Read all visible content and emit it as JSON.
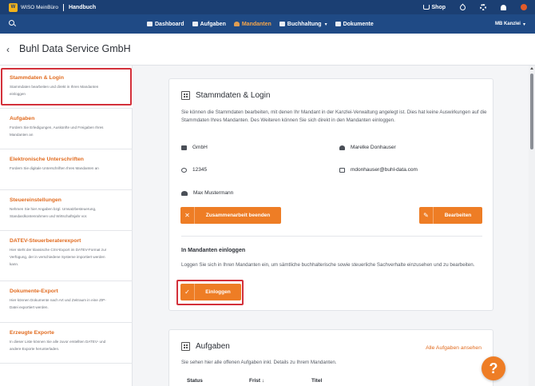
{
  "topbar": {
    "brand": "WISO MeinBüro",
    "handbook": "Handbuch",
    "shop": "Shop"
  },
  "nav": {
    "items": [
      {
        "label": "Dashboard"
      },
      {
        "label": "Aufgaben"
      },
      {
        "label": "Mandanten",
        "active": true
      },
      {
        "label": "Buchhaltung",
        "dropdown": true
      },
      {
        "label": "Dokumente"
      }
    ],
    "kanzlei": "MB Kanzlei"
  },
  "page": {
    "title": "Buhl Data Service GmbH"
  },
  "sidebar": {
    "items": [
      {
        "label": "Stammdaten & Login",
        "desc": "Stammdaten bearbeiten und direkt in Ihren Mandanten einloggen"
      },
      {
        "label": "Aufgaben",
        "desc": "Fordern Sie Erledigungen, Auskünfte und Freigaben Ihres Mandanten an"
      },
      {
        "label": "Elektronische Unterschriften",
        "desc": "Fordern Sie digitale Unterschriften Ihres Mandanten an"
      },
      {
        "label": "Steuereinstellungen",
        "desc": "Nehmen Sie hier Angaben bzgl. Umsatzbesteuerung, Standardkontenrahmen und Wirtschaftsjahr vor."
      },
      {
        "label": "DATEV-Steuerberaterexport",
        "desc": "Hier steht der klassische CSV-Export im DATEV-Format zur Verfügung, der in verschiedene Systeme importiert werden kann."
      },
      {
        "label": "Dokumente-Export",
        "desc": "Hier können Dokumente nach Art und Zeitraum in eine ZIP-Datei exportiert werden."
      },
      {
        "label": "Erzeugte Exporte",
        "desc": "In dieser Liste können Sie alle zuvor erstellten DATEV- und andere Exporte herunterladen."
      }
    ]
  },
  "stammdaten": {
    "title": "Stammdaten & Login",
    "intro": "Sie können die Stammdaten bearbeiten, mit denen Ihr Mandant in der Kanzlei-Verwaltung angelegt ist. Dies hat keine Auswirkungen auf die Stammdaten Ihres Mandanten. Des Weiteren können Sie sich direkt in den Mandanten einloggen.",
    "company": "GmbH",
    "contact": "Marelke Donhauser",
    "number": "12345",
    "email": "mdonhauser@buhl-data.com",
    "advisor": "Max Mustermann",
    "end_button": "Zusammenarbeit beenden",
    "edit_button": "Bearbeiten",
    "login_head": "In Mandanten einloggen",
    "login_text": "Loggen Sie sich in Ihren Mandanten ein, um sämtliche buchhalterische sowie steuerliche Sachverhalte einzusehen und zu bearbeiten.",
    "login_button": "Einloggen"
  },
  "aufgaben": {
    "title": "Aufgaben",
    "link": "Alle Aufgaben ansehen",
    "intro": "Sie sehen hier alle offenen Aufgaben inkl. Details zu Ihrem Mandanten.",
    "columns": [
      "Status",
      "Frist ↓",
      "Titel"
    ]
  },
  "help": "?"
}
